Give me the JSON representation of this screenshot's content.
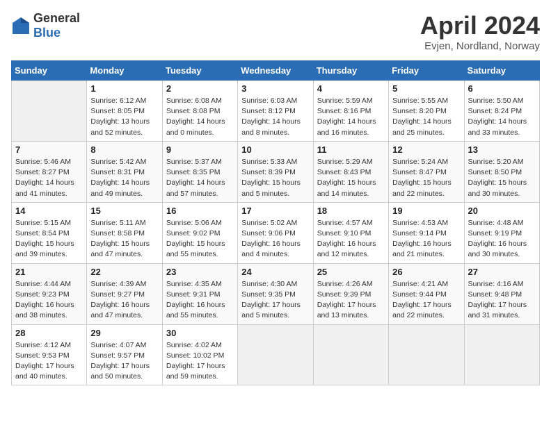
{
  "header": {
    "logo_general": "General",
    "logo_blue": "Blue",
    "month_title": "April 2024",
    "location": "Evjen, Nordland, Norway"
  },
  "weekdays": [
    "Sunday",
    "Monday",
    "Tuesday",
    "Wednesday",
    "Thursday",
    "Friday",
    "Saturday"
  ],
  "weeks": [
    [
      {
        "day": "",
        "info": ""
      },
      {
        "day": "1",
        "info": "Sunrise: 6:12 AM\nSunset: 8:05 PM\nDaylight: 13 hours\nand 52 minutes."
      },
      {
        "day": "2",
        "info": "Sunrise: 6:08 AM\nSunset: 8:08 PM\nDaylight: 14 hours\nand 0 minutes."
      },
      {
        "day": "3",
        "info": "Sunrise: 6:03 AM\nSunset: 8:12 PM\nDaylight: 14 hours\nand 8 minutes."
      },
      {
        "day": "4",
        "info": "Sunrise: 5:59 AM\nSunset: 8:16 PM\nDaylight: 14 hours\nand 16 minutes."
      },
      {
        "day": "5",
        "info": "Sunrise: 5:55 AM\nSunset: 8:20 PM\nDaylight: 14 hours\nand 25 minutes."
      },
      {
        "day": "6",
        "info": "Sunrise: 5:50 AM\nSunset: 8:24 PM\nDaylight: 14 hours\nand 33 minutes."
      }
    ],
    [
      {
        "day": "7",
        "info": "Sunrise: 5:46 AM\nSunset: 8:27 PM\nDaylight: 14 hours\nand 41 minutes."
      },
      {
        "day": "8",
        "info": "Sunrise: 5:42 AM\nSunset: 8:31 PM\nDaylight: 14 hours\nand 49 minutes."
      },
      {
        "day": "9",
        "info": "Sunrise: 5:37 AM\nSunset: 8:35 PM\nDaylight: 14 hours\nand 57 minutes."
      },
      {
        "day": "10",
        "info": "Sunrise: 5:33 AM\nSunset: 8:39 PM\nDaylight: 15 hours\nand 5 minutes."
      },
      {
        "day": "11",
        "info": "Sunrise: 5:29 AM\nSunset: 8:43 PM\nDaylight: 15 hours\nand 14 minutes."
      },
      {
        "day": "12",
        "info": "Sunrise: 5:24 AM\nSunset: 8:47 PM\nDaylight: 15 hours\nand 22 minutes."
      },
      {
        "day": "13",
        "info": "Sunrise: 5:20 AM\nSunset: 8:50 PM\nDaylight: 15 hours\nand 30 minutes."
      }
    ],
    [
      {
        "day": "14",
        "info": "Sunrise: 5:15 AM\nSunset: 8:54 PM\nDaylight: 15 hours\nand 39 minutes."
      },
      {
        "day": "15",
        "info": "Sunrise: 5:11 AM\nSunset: 8:58 PM\nDaylight: 15 hours\nand 47 minutes."
      },
      {
        "day": "16",
        "info": "Sunrise: 5:06 AM\nSunset: 9:02 PM\nDaylight: 15 hours\nand 55 minutes."
      },
      {
        "day": "17",
        "info": "Sunrise: 5:02 AM\nSunset: 9:06 PM\nDaylight: 16 hours\nand 4 minutes."
      },
      {
        "day": "18",
        "info": "Sunrise: 4:57 AM\nSunset: 9:10 PM\nDaylight: 16 hours\nand 12 minutes."
      },
      {
        "day": "19",
        "info": "Sunrise: 4:53 AM\nSunset: 9:14 PM\nDaylight: 16 hours\nand 21 minutes."
      },
      {
        "day": "20",
        "info": "Sunrise: 4:48 AM\nSunset: 9:19 PM\nDaylight: 16 hours\nand 30 minutes."
      }
    ],
    [
      {
        "day": "21",
        "info": "Sunrise: 4:44 AM\nSunset: 9:23 PM\nDaylight: 16 hours\nand 38 minutes."
      },
      {
        "day": "22",
        "info": "Sunrise: 4:39 AM\nSunset: 9:27 PM\nDaylight: 16 hours\nand 47 minutes."
      },
      {
        "day": "23",
        "info": "Sunrise: 4:35 AM\nSunset: 9:31 PM\nDaylight: 16 hours\nand 55 minutes."
      },
      {
        "day": "24",
        "info": "Sunrise: 4:30 AM\nSunset: 9:35 PM\nDaylight: 17 hours\nand 5 minutes."
      },
      {
        "day": "25",
        "info": "Sunrise: 4:26 AM\nSunset: 9:39 PM\nDaylight: 17 hours\nand 13 minutes."
      },
      {
        "day": "26",
        "info": "Sunrise: 4:21 AM\nSunset: 9:44 PM\nDaylight: 17 hours\nand 22 minutes."
      },
      {
        "day": "27",
        "info": "Sunrise: 4:16 AM\nSunset: 9:48 PM\nDaylight: 17 hours\nand 31 minutes."
      }
    ],
    [
      {
        "day": "28",
        "info": "Sunrise: 4:12 AM\nSunset: 9:53 PM\nDaylight: 17 hours\nand 40 minutes."
      },
      {
        "day": "29",
        "info": "Sunrise: 4:07 AM\nSunset: 9:57 PM\nDaylight: 17 hours\nand 50 minutes."
      },
      {
        "day": "30",
        "info": "Sunrise: 4:02 AM\nSunset: 10:02 PM\nDaylight: 17 hours\nand 59 minutes."
      },
      {
        "day": "",
        "info": ""
      },
      {
        "day": "",
        "info": ""
      },
      {
        "day": "",
        "info": ""
      },
      {
        "day": "",
        "info": ""
      }
    ]
  ]
}
